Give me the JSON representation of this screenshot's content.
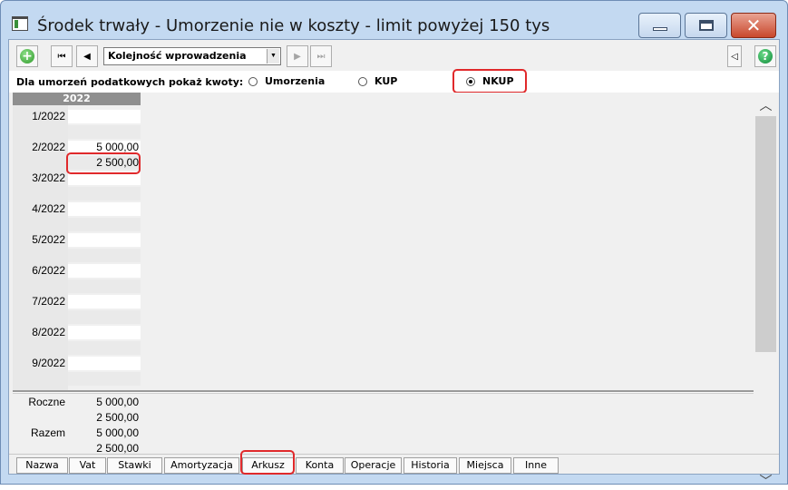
{
  "window": {
    "title": "Środek trwały - Umorzenie nie w koszty - limit powyżej 150 tys",
    "min_label": "",
    "max_label": "",
    "close_label": "✕"
  },
  "toolbar": {
    "first_glyph": "⏮",
    "prev_glyph": "◀",
    "sort_value": "Kolejność wprowadzenia",
    "dropdown_glyph": "▼",
    "next_glyph": "▶",
    "last_glyph": "⏭",
    "panel_glyph": "◁",
    "add_glyph": "+",
    "help_glyph": "?"
  },
  "options": {
    "label": "Dla umorzeń podatkowych pokaż kwoty:",
    "radios": [
      {
        "label": "Umorzenia",
        "selected": false
      },
      {
        "label": "KUP",
        "selected": false
      },
      {
        "label": "NKUP",
        "selected": true
      }
    ]
  },
  "grid": {
    "year": "2022",
    "rows": [
      {
        "label": "1/2022",
        "v1": "",
        "v2": ""
      },
      {
        "label": "2/2022",
        "v1": "5 000,00",
        "v2": "2 500,00"
      },
      {
        "label": "3/2022",
        "v1": "",
        "v2": ""
      },
      {
        "label": "4/2022",
        "v1": "",
        "v2": ""
      },
      {
        "label": "5/2022",
        "v1": "",
        "v2": ""
      },
      {
        "label": "6/2022",
        "v1": "",
        "v2": ""
      },
      {
        "label": "7/2022",
        "v1": "",
        "v2": ""
      },
      {
        "label": "8/2022",
        "v1": "",
        "v2": ""
      },
      {
        "label": "9/2022",
        "v1": "",
        "v2": ""
      }
    ]
  },
  "summary": {
    "rows": [
      {
        "label": "Roczne",
        "v1": "5 000,00",
        "v2": "2 500,00"
      },
      {
        "label": "Razem",
        "v1": "5 000,00",
        "v2": "2 500,00"
      }
    ]
  },
  "scroll": {
    "up": "︿",
    "down": "﹀"
  },
  "tabs": [
    "Nazwa",
    "Vat",
    "Stawki",
    "Amortyzacja",
    "Arkusz",
    "Konta",
    "Operacje",
    "Historia",
    "Miejsca",
    "Inne"
  ],
  "colors": {
    "highlight": "#e0292b",
    "title_bar": "#c3d9f1",
    "close_button": "#c9482c"
  }
}
